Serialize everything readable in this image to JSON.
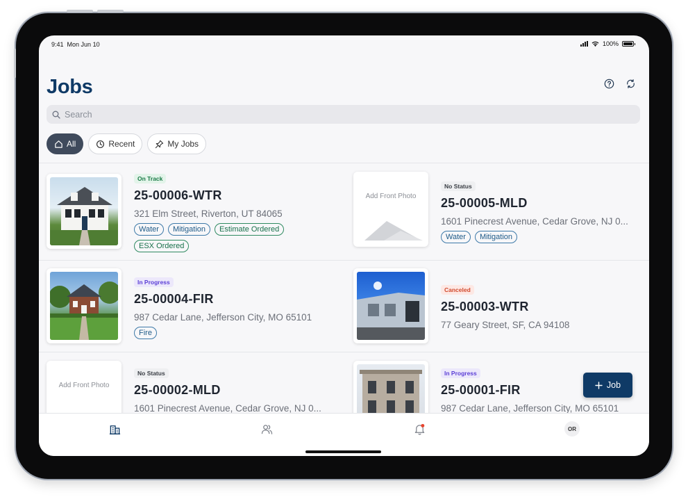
{
  "status_bar": {
    "time": "9:41",
    "date": "Mon Jun 10",
    "battery": "100%"
  },
  "header": {
    "title": "Jobs"
  },
  "search": {
    "placeholder": "Search"
  },
  "filters": [
    {
      "label": "All",
      "icon": "house-icon",
      "active": true
    },
    {
      "label": "Recent",
      "icon": "clock-icon",
      "active": false
    },
    {
      "label": "My Jobs",
      "icon": "pin-icon",
      "active": false
    }
  ],
  "jobs": [
    {
      "status": "On Track",
      "id": "25-00006-WTR",
      "address": "321 Elm Street, Riverton, UT 84065",
      "tags": [
        "Water",
        "Mitigation",
        "Estimate Ordered",
        "ESX Ordered"
      ],
      "photo": "house-white-colonial"
    },
    {
      "status": "No Status",
      "id": "25-00005-MLD",
      "address": "1601 Pinecrest Avenue, Cedar Grove, NJ 0...",
      "tags": [
        "Water",
        "Mitigation"
      ],
      "photo": "placeholder",
      "photo_label": "Add Front Photo"
    },
    {
      "status": "In Progress",
      "id": "25-00004-FIR",
      "address": "987 Cedar Lane, Jefferson City, MO 65101",
      "tags": [
        "Fire"
      ],
      "photo": "house-brick-garden"
    },
    {
      "status": "Canceled",
      "id": "25-00003-WTR",
      "address": "77 Geary Street, SF, CA 94108",
      "tags": [],
      "photo": "house-blue-sky"
    },
    {
      "status": "No Status",
      "id": "25-00002-MLD",
      "address": "1601 Pinecrest Avenue, Cedar Grove, NJ 0...",
      "tags": [],
      "photo": "placeholder",
      "photo_label": "Add Front Photo"
    },
    {
      "status": "In Progress",
      "id": "25-00001-FIR",
      "address": "987 Cedar Lane, Jefferson City, MO 65101",
      "tags": [],
      "photo": "house-victorian"
    }
  ],
  "fab": {
    "label": "Job",
    "icon": "plus-icon"
  },
  "tabbar": {
    "profile_initials": "OR"
  },
  "colors": {
    "brand": "#0f3a66",
    "on_track": "#1b7a47",
    "in_progress": "#5b3fd6",
    "canceled": "#d14b2f",
    "tag_blue": "#1e5a88",
    "tag_green": "#17704a"
  }
}
